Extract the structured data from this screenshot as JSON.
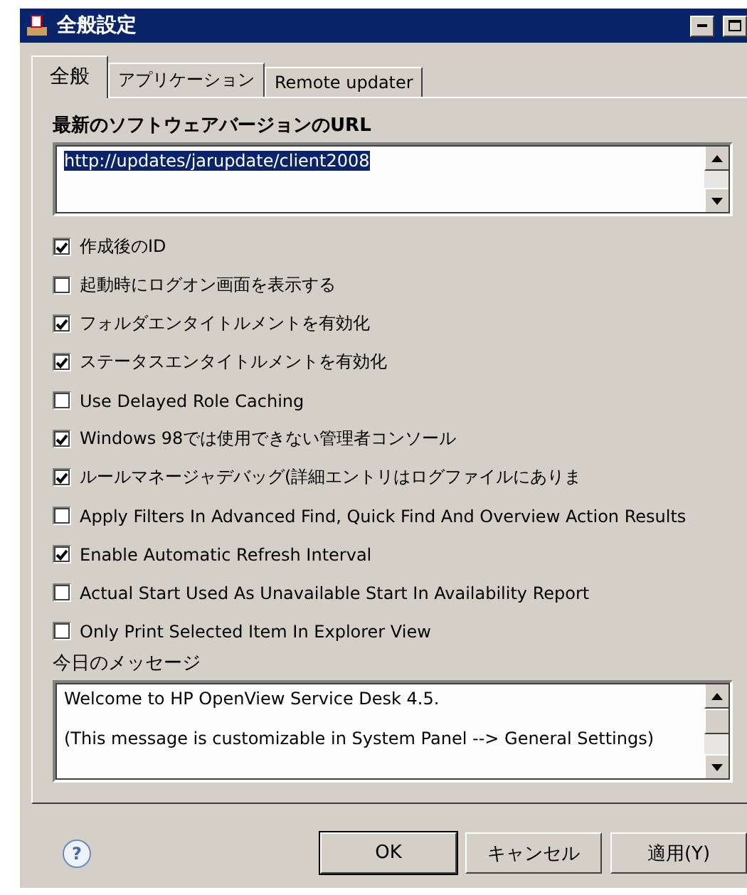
{
  "window": {
    "title": "全般設定"
  },
  "tabs": [
    {
      "label": "全般",
      "selected": true
    },
    {
      "label": "アプリケーション",
      "selected": false
    },
    {
      "label": "Remote updater",
      "selected": false
    }
  ],
  "url_field": {
    "label": "最新のソフトウェアバージョンのURL",
    "value": "http://updates/jarupdate/client2008"
  },
  "options": [
    {
      "label": "作成後のID",
      "checked": true
    },
    {
      "label": "起動時にログオン画面を表示する",
      "checked": false
    },
    {
      "label": "フォルダエンタイトルメントを有効化",
      "checked": true
    },
    {
      "label": "ステータスエンタイトルメントを有効化",
      "checked": true
    },
    {
      "label": "Use Delayed Role Caching",
      "checked": false
    },
    {
      "label": "Windows 98では使用できない管理者コンソール",
      "checked": true
    },
    {
      "label": "ルールマネージャデバッグ(詳細エントリはログファイルにありま",
      "checked": true
    },
    {
      "label": "Apply Filters In Advanced Find, Quick Find And Overview Action Results",
      "checked": false
    },
    {
      "label": "Enable Automatic Refresh Interval",
      "checked": true
    },
    {
      "label": "Actual Start Used As Unavailable Start In Availability Report",
      "checked": false
    },
    {
      "label": "Only Print Selected Item In Explorer View",
      "checked": false
    }
  ],
  "message": {
    "label": "今日のメッセージ",
    "lines": [
      "Welcome to HP OpenView Service Desk 4.5.",
      "(This message is customizable in System Panel --> General Settings)"
    ]
  },
  "help": "?",
  "buttons": [
    "OK",
    "キャンセル",
    "適用(Y)"
  ]
}
